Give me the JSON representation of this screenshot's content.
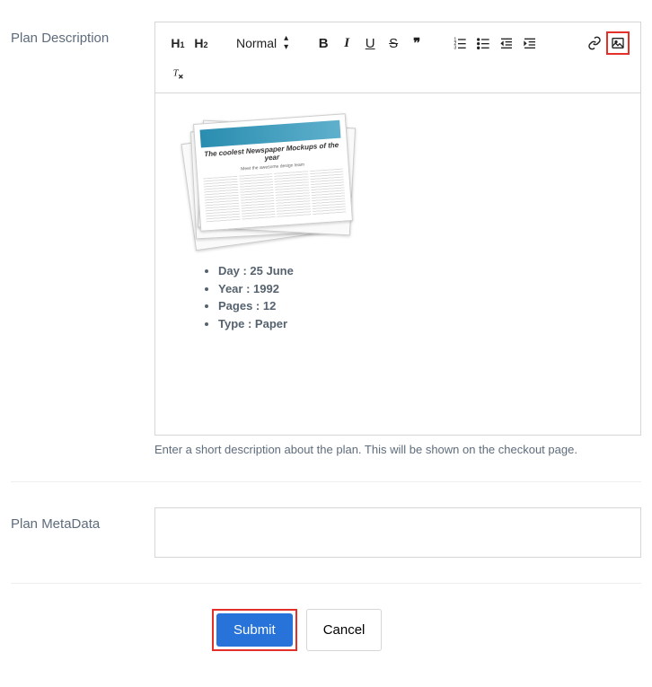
{
  "labels": {
    "plan_description": "Plan Description",
    "plan_metadata": "Plan MetaData"
  },
  "toolbar": {
    "h1": "H",
    "h1_sub": "1",
    "h2": "H",
    "h2_sub": "2",
    "format_select": "Normal",
    "bold": "B",
    "italic": "I",
    "underline": "U",
    "strike": "S",
    "quote": "❞"
  },
  "editor_content": {
    "newspaper_headline": "The coolest Newspaper Mockups of the year",
    "newspaper_sub": "Meet the awesome design team",
    "bullets": [
      "Day : 25 June",
      "Year : 1992",
      "Pages : 12",
      "Type : Paper"
    ]
  },
  "help_text": "Enter a short description about the plan. This will be shown on the checkout page.",
  "metadata_value": "",
  "buttons": {
    "submit": "Submit",
    "cancel": "Cancel"
  }
}
